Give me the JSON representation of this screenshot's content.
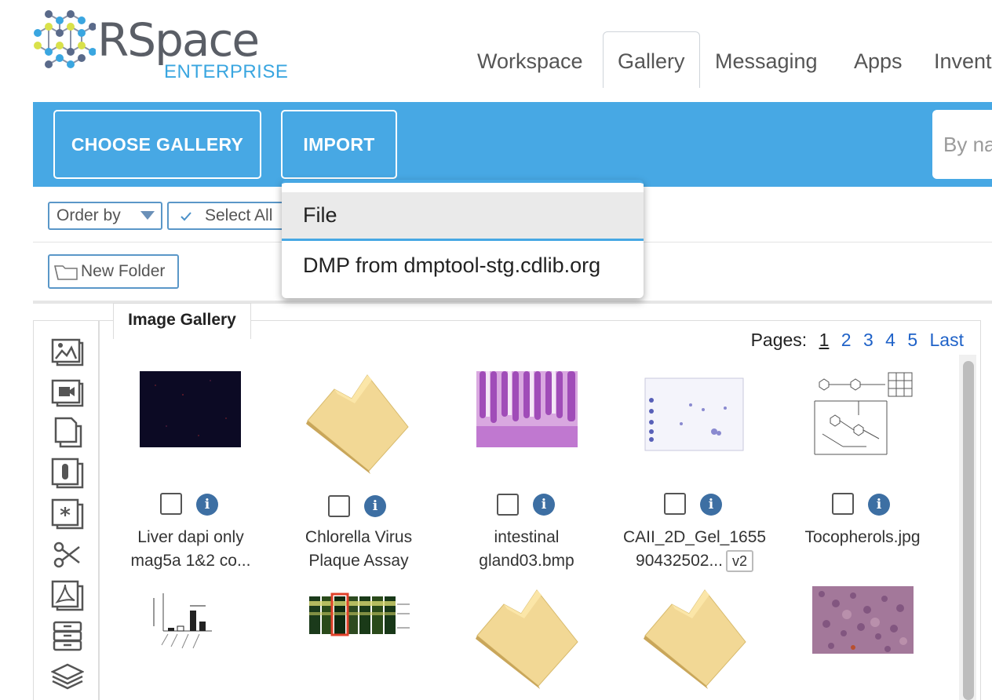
{
  "header": {
    "logo_main": "RSpace",
    "logo_sub": "ENTERPRISE",
    "nav": [
      "Workspace",
      "Gallery",
      "Messaging",
      "Apps",
      "Invent"
    ],
    "active_nav": "Gallery"
  },
  "toolbar": {
    "choose_gallery": "CHOOSE GALLERY",
    "import": "IMPORT",
    "search_placeholder": "By na"
  },
  "filters": {
    "order_by": "Order by",
    "select_all": "Select All",
    "new_folder": "New Folder"
  },
  "import_menu": {
    "items": [
      "File",
      "DMP from dmptool-stg.cdlib.org"
    ],
    "highlighted": "File"
  },
  "gallery": {
    "tab_label": "Image Gallery",
    "pages_label": "Pages:",
    "pages": [
      "1",
      "2",
      "3",
      "4",
      "5"
    ],
    "current_page": "1",
    "last_label": "Last",
    "items": [
      {
        "line1": "Liver dapi only",
        "line2": "mag5a 1&2 co...",
        "kind": "dark-micrograph"
      },
      {
        "line1": "Chlorella Virus",
        "line2": "Plaque Assay",
        "kind": "folder"
      },
      {
        "line1": "intestinal",
        "line2": "gland03.bmp",
        "kind": "histology"
      },
      {
        "line1": "CAII_2D_Gel_1655",
        "line2": "90432502...",
        "badge": "v2",
        "kind": "gel"
      },
      {
        "line1": "Tocopherols.jpg",
        "line2": "",
        "kind": "structure"
      }
    ],
    "row2": [
      "bar-chart",
      "gel-lanes",
      "folder",
      "folder",
      "tissue"
    ]
  },
  "sidebar_icons": [
    "image-icon",
    "video-icon",
    "documents-icon",
    "chemistry-icon",
    "snippet-icon",
    "miscellaneous-icon",
    "pdf-icon",
    "filestore-icon",
    "layers-icon"
  ],
  "colors": {
    "accent": "#47a8e4",
    "link": "#1f62c8",
    "info": "#3d6fa3",
    "folder": "#f2d895"
  }
}
